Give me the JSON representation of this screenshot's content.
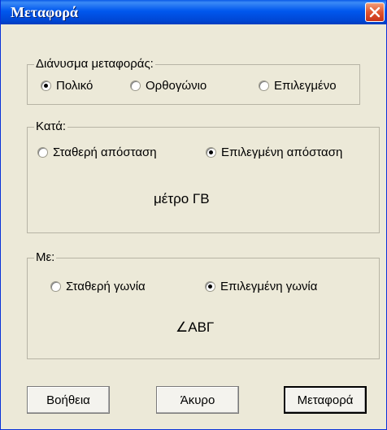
{
  "window": {
    "title": "Μεταφορά"
  },
  "vector_group": {
    "legend": "Διάνυσμα μεταφοράς:",
    "options": [
      {
        "label": "Πολικό",
        "checked": true
      },
      {
        "label": "Ορθογώνιο",
        "checked": false
      },
      {
        "label": "Επιλεγμένο",
        "checked": false
      }
    ]
  },
  "distance_group": {
    "legend": "Κατά:",
    "options": [
      {
        "label": "Σταθερή απόσταση",
        "checked": false
      },
      {
        "label": "Επιλεγμένη απόσταση",
        "checked": true
      }
    ],
    "value": "μέτρο ΓΒ"
  },
  "angle_group": {
    "legend": "Με:",
    "options": [
      {
        "label": "Σταθερή γωνία",
        "checked": false
      },
      {
        "label": "Επιλεγμένη γωνία",
        "checked": true
      }
    ],
    "value": "∠ΑΒΓ"
  },
  "buttons": {
    "help": "Βοήθεια",
    "cancel": "Άκυρο",
    "ok": "Μεταφορά"
  },
  "colors": {
    "title_bar": "#0058ee",
    "dialog_bg": "#ece9d8",
    "close_button": "#e0542e"
  }
}
